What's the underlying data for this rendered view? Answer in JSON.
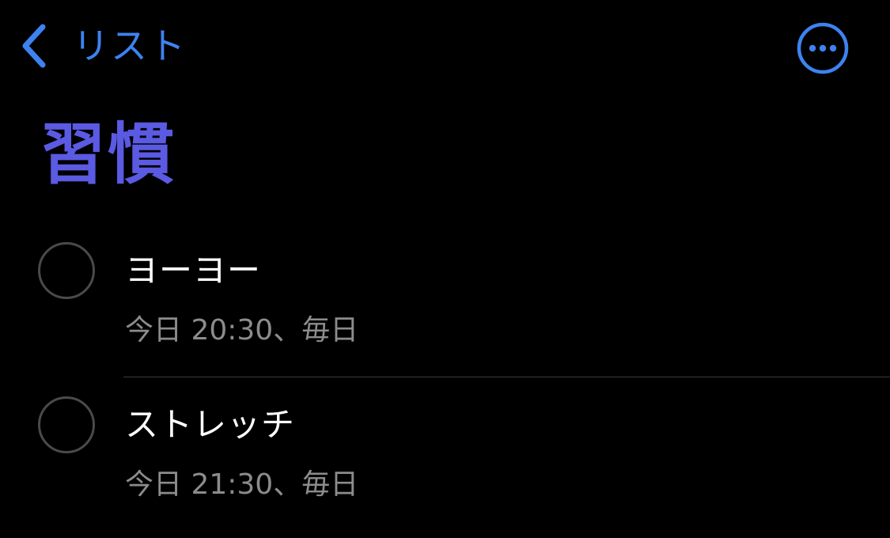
{
  "colors": {
    "accent_blue": "#3d82f0",
    "list_color": "#5b5ae2",
    "background": "#000000",
    "secondary_text": "#8c8c8c",
    "circle_border": "#4a4a4a"
  },
  "nav": {
    "back_label": "リスト",
    "back_icon": "chevron-left-icon",
    "more_icon": "ellipsis-circle-icon"
  },
  "list": {
    "title": "習慣"
  },
  "items": [
    {
      "title": "ヨーヨー",
      "subtitle": "今日 20:30、毎日"
    },
    {
      "title": "ストレッチ",
      "subtitle": "今日 21:30、毎日"
    }
  ]
}
